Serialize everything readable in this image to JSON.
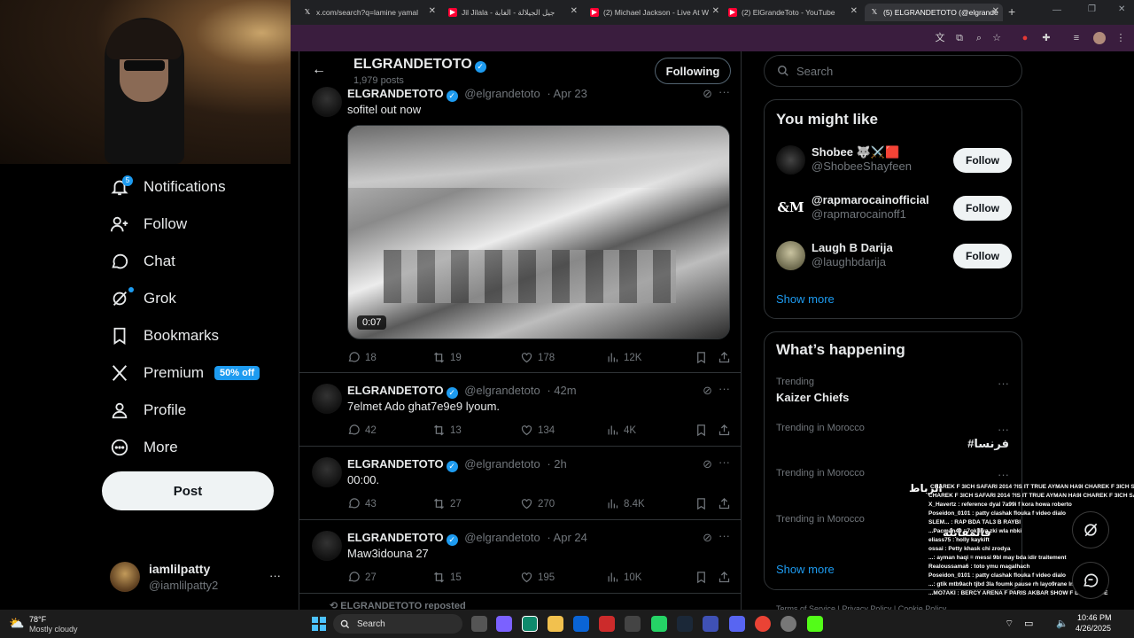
{
  "browser": {
    "tabs": [
      {
        "title": "x.com/search?q=lamine yamal",
        "icon": "x-logo-icon",
        "color": "#000000"
      },
      {
        "title": "Jil Jilala - جيل الجيلالة - الغابة",
        "icon": "youtube-icon",
        "color": "#ff0033"
      },
      {
        "title": "(2) Michael Jackson - Live At W",
        "icon": "youtube-icon",
        "color": "#ff0033"
      },
      {
        "title": "(2) ElGrandeToto - YouTube",
        "icon": "youtube-icon",
        "color": "#ff0033"
      },
      {
        "title": "(5) ELGRANDETOTO (@elgrande",
        "icon": "x-logo-icon",
        "color": "#000000"
      }
    ],
    "new_tab": "+",
    "active_tab": 4
  },
  "sidebar": {
    "items": [
      {
        "label": "Notifications",
        "icon": "bell-icon",
        "badge": "5"
      },
      {
        "label": "Follow",
        "icon": "follow-icon"
      },
      {
        "label": "Chat",
        "icon": "chat-icon"
      },
      {
        "label": "Grok",
        "icon": "grok-icon"
      },
      {
        "label": "Bookmarks",
        "icon": "bookmark-icon"
      },
      {
        "label": "Premium",
        "icon": "x-logo-icon",
        "badge": "50% off"
      },
      {
        "label": "Profile",
        "icon": "person-icon"
      },
      {
        "label": "More",
        "icon": "more-circle-icon"
      }
    ],
    "post_label": "Post",
    "account": {
      "name": "iamlilpatty",
      "handle": "@iamlilpatty2",
      "more": "···"
    }
  },
  "header": {
    "title": "ELGRANDETOTO",
    "posts_count": "1,979 posts",
    "following_label": "Following"
  },
  "tweets": [
    {
      "name": "ELGRANDETOTO",
      "handle": "@elgrandetoto",
      "time": "· Apr 23",
      "text": "sofitel out now",
      "video_duration": "0:07",
      "replies": "18",
      "reposts": "19",
      "likes": "178",
      "views": "12K"
    },
    {
      "name": "ELGRANDETOTO",
      "handle": "@elgrandetoto",
      "time": "· 42m",
      "text": "7elmet Ado ghat7e9e9 lyoum.",
      "replies": "42",
      "reposts": "13",
      "likes": "134",
      "views": "4K"
    },
    {
      "name": "ELGRANDETOTO",
      "handle": "@elgrandetoto",
      "time": "· 2h",
      "text": "00:00.",
      "replies": "43",
      "reposts": "27",
      "likes": "270",
      "views": "8.4K"
    },
    {
      "name": "ELGRANDETOTO",
      "handle": "@elgrandetoto",
      "time": "· Apr 24",
      "text": "Maw3idouna 27",
      "replies": "27",
      "reposts": "15",
      "likes": "195",
      "views": "10K"
    }
  ],
  "reposted_label": "ELGRANDETOTO reposted",
  "search": {
    "placeholder": "Search"
  },
  "you_might_like": {
    "title": "You might like",
    "items": [
      {
        "name": "Shobee 🐺⚔️🟥",
        "handle": "@ShobeeShayfeen",
        "button": "Follow"
      },
      {
        "name": "@rapmarocainofficial",
        "handle": "@rapmarocainoff1",
        "button": "Follow"
      },
      {
        "name": "Laugh B Darija",
        "handle": "@laughbdarija",
        "button": "Follow"
      }
    ],
    "show_more": "Show more"
  },
  "whats_happening": {
    "title": "What’s happening",
    "trends": [
      {
        "meta": "Trending",
        "name": "Kaizer Chiefs"
      },
      {
        "meta": "Trending in Morocco",
        "name": "#فرنسا"
      },
      {
        "meta": "Trending in Morocco",
        "name": "الرباط"
      },
      {
        "meta": "Trending in Morocco",
        "name": "فالمقابلة"
      }
    ],
    "show_more": "Show more"
  },
  "footer_links": "Terms of Service  |  Privacy Policy  |  Cookie Policy",
  "chat_overlay": [
    "CHAREK F 3ICH SAFARI 2014 ?IS IT TRUE AYMAN HA9I CHAREK F 3ICH SAFARI 2014 ?IS IT TRUE AYMAN HA9I",
    "CHAREK F 3ICH SAFARI 2014 ?IS IT TRUE AYMAN HA9I CHAREK F 3ICH SAFARI 2014 ?",
    "X_Havertz : reference dyal 7a99i f kora howa roberto",
    "Poseidon_0101 : patty clashak flouka f video dialo",
    "SLEM... : RAP BDA TAL3 B RAYBI",
    "...Pacman49 : 7ok liya zki wla nbki",
    "eliass75 : holly kaykift",
    "ossai : Petty khask chi zrodya",
    "...: ayman haqi = messi 9bl may bda idir traitement",
    "Realoussama6 : toto ymu magalhach",
    "Poseidon_0101 : patty clashak flouka f video dialo",
    "...: gtik mtb9ach tjbd 3la foumk pause rh layo9rane lmoskh lwdik",
    "...MO7AKI : BERCY ARENA F PARIS AKBAR SHOW F LA FRANCE"
  ],
  "taskbar": {
    "weather_temp": "78°F",
    "weather_desc": "Mostly cloudy",
    "search_label": "Search",
    "time": "10:46 PM",
    "date": "4/26/2025"
  }
}
